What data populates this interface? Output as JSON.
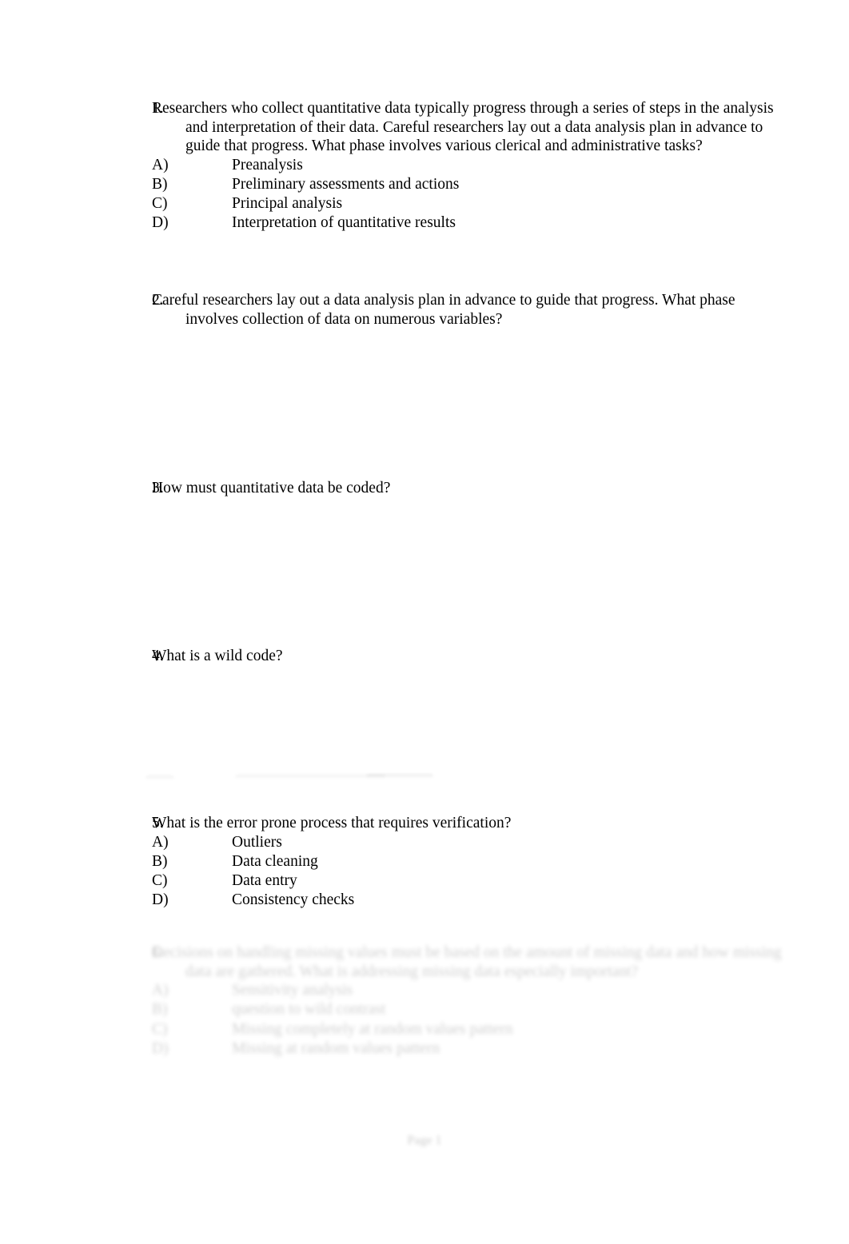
{
  "document": {
    "background_color": "#ffffff",
    "text_color": "#000000",
    "footer": "Page 1"
  },
  "questions": [
    {
      "number": "1.",
      "stem": "Researchers who collect quantitative data typically progress through a series of steps in the analysis and interpretation of their data. Careful researchers lay out a data analysis plan in advance to guide that progress. What phase involves various clerical and administrative tasks?",
      "options": [
        {
          "letter": "A)",
          "text": "Preanalysis"
        },
        {
          "letter": "B)",
          "text": "Preliminary assessments and actions"
        },
        {
          "letter": "C)",
          "text": "Principal analysis"
        },
        {
          "letter": "D)",
          "text": "Interpretation of quantitative results"
        }
      ]
    },
    {
      "number": "2.",
      "stem": "Careful researchers lay out a data analysis plan in advance to guide that progress. What phase involves collection of data on numerous variables?",
      "options": []
    },
    {
      "number": "3.",
      "stem": "How must quantitative data be coded?",
      "options": []
    },
    {
      "number": "4.",
      "stem": "What is a wild code?",
      "options": []
    },
    {
      "number": "5.",
      "stem": "What is the error prone process that requires verification?",
      "options": [
        {
          "letter": "A)",
          "text": "Outliers"
        },
        {
          "letter": "B)",
          "text": "Data cleaning"
        },
        {
          "letter": "C)",
          "text": "Data entry"
        },
        {
          "letter": "D)",
          "text": "Consistency checks"
        }
      ]
    },
    {
      "number": "6.",
      "faded": true,
      "stem": "Decisions on handling missing values must be based on the amount of missing data and how missing data are gathered. What is addressing missing data especially important?",
      "options": [
        {
          "letter": "A)",
          "text": "Sensitivity analysis"
        },
        {
          "letter": "B)",
          "text": "question to wild contrast"
        },
        {
          "letter": "C)",
          "text": "Missing completely at random values pattern"
        },
        {
          "letter": "D)",
          "text": "Missing at random values pattern"
        }
      ]
    }
  ]
}
